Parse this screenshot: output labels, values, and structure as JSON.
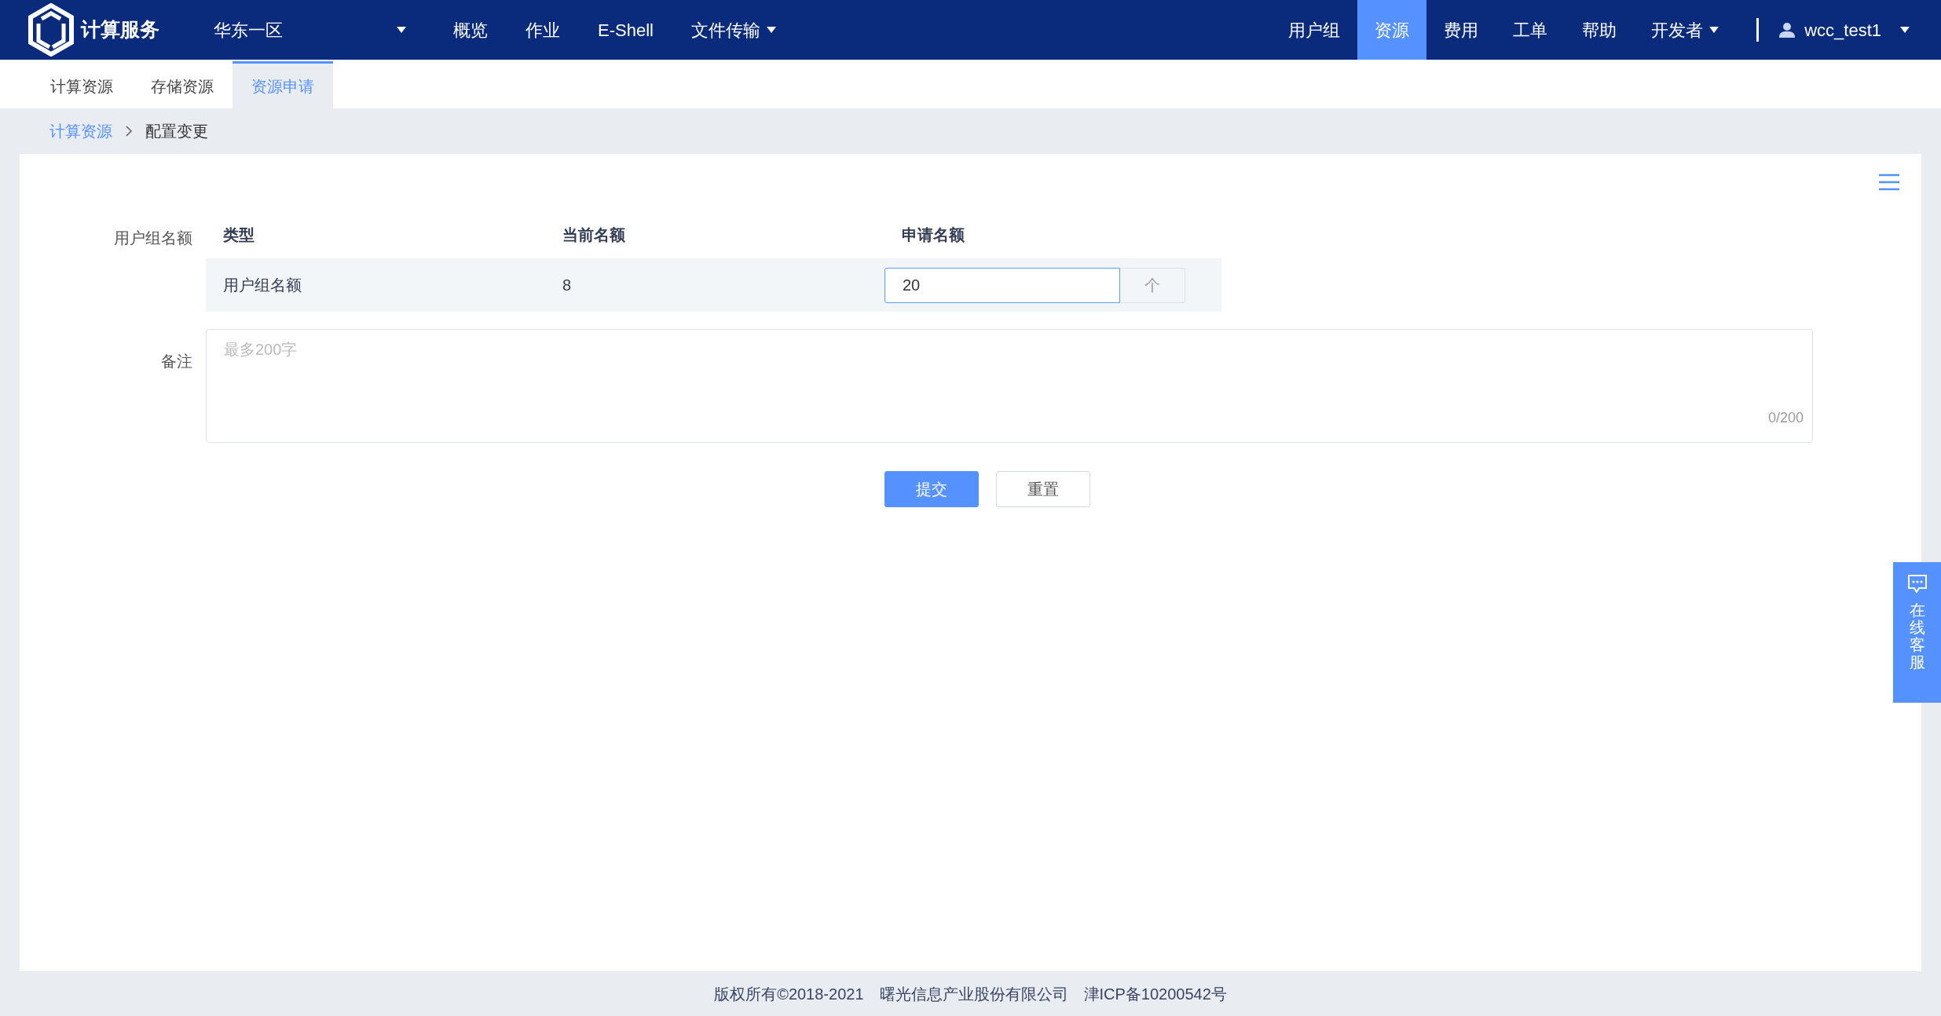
{
  "header": {
    "brand": "计算服务",
    "region": "华东一区",
    "nav_left": [
      {
        "label": "概览",
        "dropdown": false
      },
      {
        "label": "作业",
        "dropdown": false
      },
      {
        "label": "E-Shell",
        "dropdown": false
      },
      {
        "label": "文件传输",
        "dropdown": true
      }
    ],
    "nav_right": [
      {
        "label": "用户组",
        "selected": false,
        "dropdown": false
      },
      {
        "label": "资源",
        "selected": true,
        "dropdown": false
      },
      {
        "label": "费用",
        "selected": false,
        "dropdown": false
      },
      {
        "label": "工单",
        "selected": false,
        "dropdown": false
      },
      {
        "label": "帮助",
        "selected": false,
        "dropdown": false
      },
      {
        "label": "开发者",
        "selected": false,
        "dropdown": true
      }
    ],
    "user": "wcc_test1"
  },
  "tabs": [
    {
      "label": "计算资源",
      "selected": false
    },
    {
      "label": "存储资源",
      "selected": false
    },
    {
      "label": "资源申请",
      "selected": true
    }
  ],
  "breadcrumb": [
    {
      "label": "计算资源",
      "link": true
    },
    {
      "label": "配置变更",
      "link": false
    }
  ],
  "form": {
    "quota_label": "用户组名额",
    "table": {
      "columns": [
        "类型",
        "当前名额",
        "申请名额"
      ],
      "rows": [
        {
          "type": "用户组名额",
          "current": "8",
          "requested": "20",
          "step_button": "个"
        }
      ]
    },
    "remark": {
      "label": "备注",
      "placeholder": "最多200字",
      "counter": "0/200"
    },
    "buttons": [
      {
        "label": "提交",
        "kind": "primary"
      },
      {
        "label": "重置",
        "kind": "default"
      }
    ]
  },
  "side_widget": {
    "label": "在线客服"
  },
  "footer": [
    "版权所有©2018-2021",
    "曙光信息产业股份有限公司",
    "津ICP备10200542号"
  ]
}
